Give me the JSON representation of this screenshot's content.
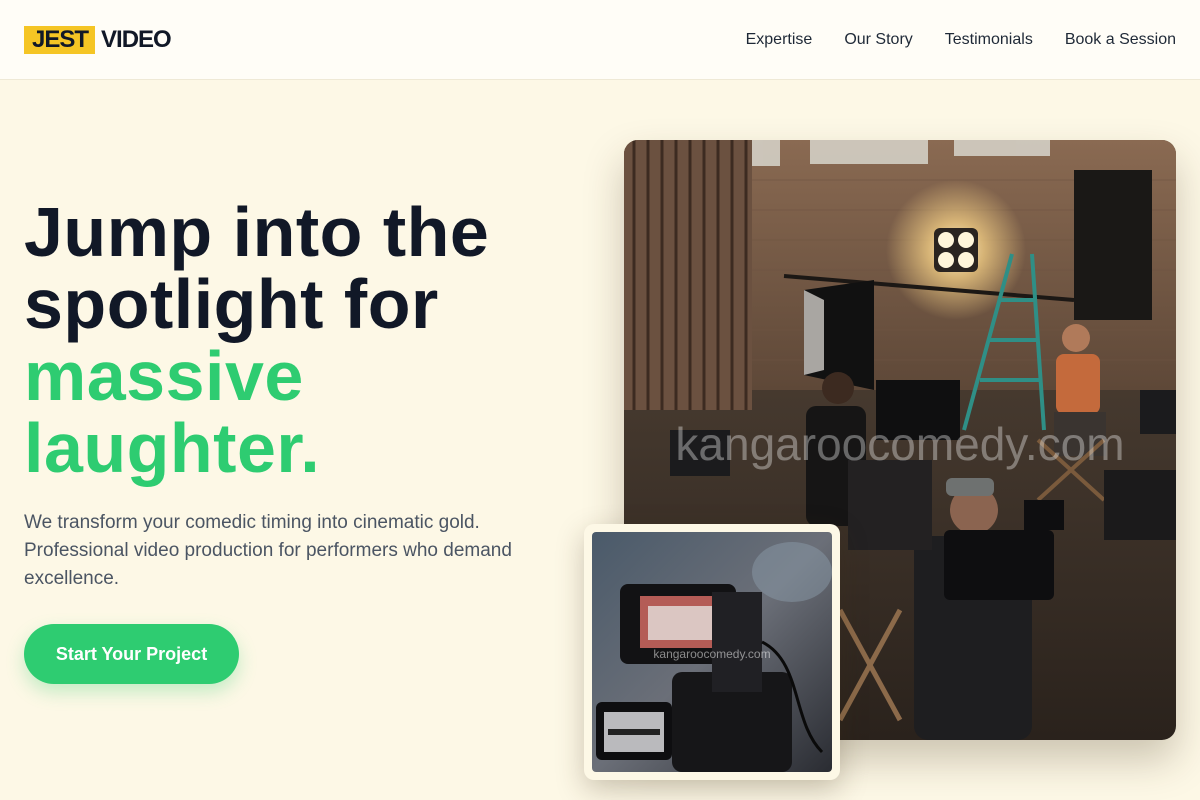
{
  "brand": {
    "name_highlight": "JEST",
    "name_rest": "VIDEO",
    "highlight_color": "#f5c524"
  },
  "nav": {
    "items": [
      {
        "label": "Expertise"
      },
      {
        "label": "Our Story"
      },
      {
        "label": "Testimonials"
      },
      {
        "label": "Book a Session"
      }
    ]
  },
  "hero": {
    "title_line1": "Jump into the",
    "title_line2": "spotlight for",
    "title_accent_line1": "massive",
    "title_accent_line2": "laughter.",
    "accent_color": "#2ecc71",
    "subtitle": "We transform your comedic timing into cinematic gold. Professional video production for performers who demand excellence.",
    "cta_label": "Start Your Project"
  },
  "images": {
    "main_watermark": "kangaroocomedy.com",
    "inset_watermark": "kangaroocomedy.com"
  }
}
